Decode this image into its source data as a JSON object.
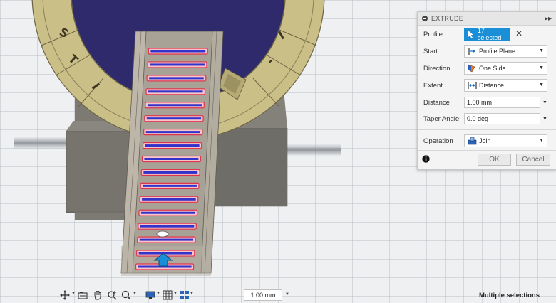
{
  "panel": {
    "title": "EXTRUDE",
    "profile": {
      "label": "Profile",
      "selection": "17 selected"
    },
    "start": {
      "label": "Start",
      "value": "Profile Plane"
    },
    "direction": {
      "label": "Direction",
      "value": "One Side"
    },
    "extent": {
      "label": "Extent",
      "value": "Distance"
    },
    "distance": {
      "label": "Distance",
      "value": "1.00 mm"
    },
    "taper": {
      "label": "Taper Angle",
      "value": "0.0 deg"
    },
    "operation": {
      "label": "Operation",
      "value": "Join"
    },
    "ok_label": "OK",
    "cancel_label": "Cancel"
  },
  "viewport": {
    "dimension_input": "1.00 mm",
    "status": "Multiple selections",
    "slot_count": 17,
    "ring_lettering": [
      "S",
      "T",
      "I",
      "I",
      "-"
    ]
  },
  "colors": {
    "selection_blue": "#1a8ed6",
    "profile_blue": "#3333cc",
    "profile_highlight": "#e0344a",
    "disc": "#2e2a6b",
    "gold": "#cabf86"
  },
  "icons": {
    "profile": "cursor-select-icon",
    "start": "profile-plane-icon",
    "direction": "one-side-icon",
    "extent": "distance-icon",
    "operation": "join-icon",
    "info": "info-icon"
  }
}
